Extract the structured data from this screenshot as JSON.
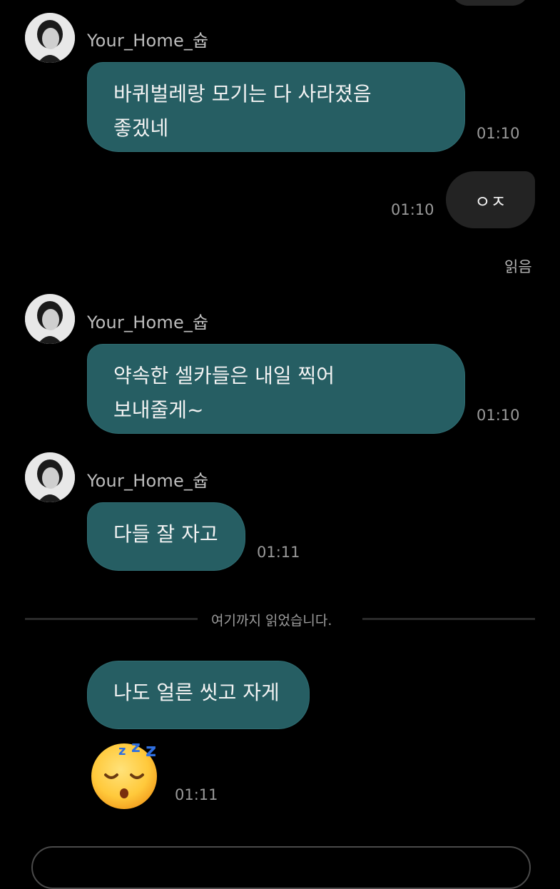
{
  "chat": {
    "sender_name": "Your_Home_슙",
    "messages": [
      {
        "text_line1": "바퀴벌레랑 모기는 다 사라졌음",
        "text_line2": "좋겠네",
        "time": "01:10"
      },
      {
        "text": "ㅇㅈ",
        "time": "01:10",
        "status": "읽음"
      },
      {
        "text_line1": "약속한 셀카들은 내일 찍어",
        "text_line2": "보내줄게~",
        "time": "01:10"
      },
      {
        "text": "다들 잘 자고",
        "time": "01:11"
      },
      {
        "text": "나도 얼른 씻고 자게"
      },
      {
        "emoji": "sleeping-face",
        "time": "01:11"
      }
    ],
    "divider_text": "여기까지 읽었습니다."
  },
  "colors": {
    "background": "#000000",
    "incoming_bubble": "#265e63",
    "outgoing_bubble": "#232323",
    "timestamp": "#9a9a9a"
  }
}
